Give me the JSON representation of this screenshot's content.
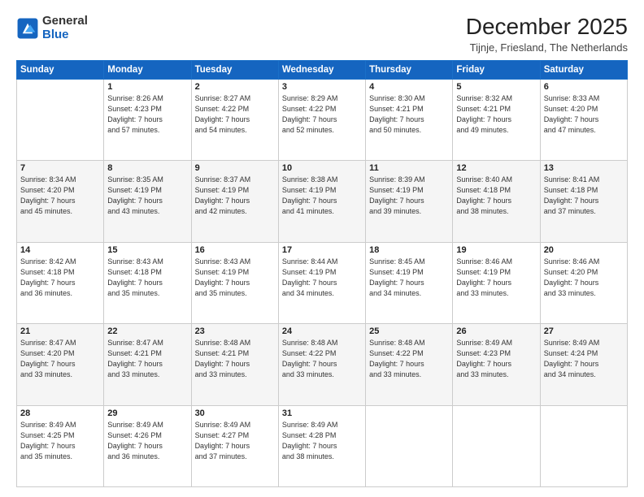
{
  "logo": {
    "line1": "General",
    "line2": "Blue"
  },
  "title": "December 2025",
  "subtitle": "Tijnje, Friesland, The Netherlands",
  "days_header": [
    "Sunday",
    "Monday",
    "Tuesday",
    "Wednesday",
    "Thursday",
    "Friday",
    "Saturday"
  ],
  "weeks": [
    [
      {
        "day": "",
        "info": ""
      },
      {
        "day": "1",
        "info": "Sunrise: 8:26 AM\nSunset: 4:23 PM\nDaylight: 7 hours\nand 57 minutes."
      },
      {
        "day": "2",
        "info": "Sunrise: 8:27 AM\nSunset: 4:22 PM\nDaylight: 7 hours\nand 54 minutes."
      },
      {
        "day": "3",
        "info": "Sunrise: 8:29 AM\nSunset: 4:22 PM\nDaylight: 7 hours\nand 52 minutes."
      },
      {
        "day": "4",
        "info": "Sunrise: 8:30 AM\nSunset: 4:21 PM\nDaylight: 7 hours\nand 50 minutes."
      },
      {
        "day": "5",
        "info": "Sunrise: 8:32 AM\nSunset: 4:21 PM\nDaylight: 7 hours\nand 49 minutes."
      },
      {
        "day": "6",
        "info": "Sunrise: 8:33 AM\nSunset: 4:20 PM\nDaylight: 7 hours\nand 47 minutes."
      }
    ],
    [
      {
        "day": "7",
        "info": "Sunrise: 8:34 AM\nSunset: 4:20 PM\nDaylight: 7 hours\nand 45 minutes."
      },
      {
        "day": "8",
        "info": "Sunrise: 8:35 AM\nSunset: 4:19 PM\nDaylight: 7 hours\nand 43 minutes."
      },
      {
        "day": "9",
        "info": "Sunrise: 8:37 AM\nSunset: 4:19 PM\nDaylight: 7 hours\nand 42 minutes."
      },
      {
        "day": "10",
        "info": "Sunrise: 8:38 AM\nSunset: 4:19 PM\nDaylight: 7 hours\nand 41 minutes."
      },
      {
        "day": "11",
        "info": "Sunrise: 8:39 AM\nSunset: 4:19 PM\nDaylight: 7 hours\nand 39 minutes."
      },
      {
        "day": "12",
        "info": "Sunrise: 8:40 AM\nSunset: 4:18 PM\nDaylight: 7 hours\nand 38 minutes."
      },
      {
        "day": "13",
        "info": "Sunrise: 8:41 AM\nSunset: 4:18 PM\nDaylight: 7 hours\nand 37 minutes."
      }
    ],
    [
      {
        "day": "14",
        "info": "Sunrise: 8:42 AM\nSunset: 4:18 PM\nDaylight: 7 hours\nand 36 minutes."
      },
      {
        "day": "15",
        "info": "Sunrise: 8:43 AM\nSunset: 4:18 PM\nDaylight: 7 hours\nand 35 minutes."
      },
      {
        "day": "16",
        "info": "Sunrise: 8:43 AM\nSunset: 4:19 PM\nDaylight: 7 hours\nand 35 minutes."
      },
      {
        "day": "17",
        "info": "Sunrise: 8:44 AM\nSunset: 4:19 PM\nDaylight: 7 hours\nand 34 minutes."
      },
      {
        "day": "18",
        "info": "Sunrise: 8:45 AM\nSunset: 4:19 PM\nDaylight: 7 hours\nand 34 minutes."
      },
      {
        "day": "19",
        "info": "Sunrise: 8:46 AM\nSunset: 4:19 PM\nDaylight: 7 hours\nand 33 minutes."
      },
      {
        "day": "20",
        "info": "Sunrise: 8:46 AM\nSunset: 4:20 PM\nDaylight: 7 hours\nand 33 minutes."
      }
    ],
    [
      {
        "day": "21",
        "info": "Sunrise: 8:47 AM\nSunset: 4:20 PM\nDaylight: 7 hours\nand 33 minutes."
      },
      {
        "day": "22",
        "info": "Sunrise: 8:47 AM\nSunset: 4:21 PM\nDaylight: 7 hours\nand 33 minutes."
      },
      {
        "day": "23",
        "info": "Sunrise: 8:48 AM\nSunset: 4:21 PM\nDaylight: 7 hours\nand 33 minutes."
      },
      {
        "day": "24",
        "info": "Sunrise: 8:48 AM\nSunset: 4:22 PM\nDaylight: 7 hours\nand 33 minutes."
      },
      {
        "day": "25",
        "info": "Sunrise: 8:48 AM\nSunset: 4:22 PM\nDaylight: 7 hours\nand 33 minutes."
      },
      {
        "day": "26",
        "info": "Sunrise: 8:49 AM\nSunset: 4:23 PM\nDaylight: 7 hours\nand 33 minutes."
      },
      {
        "day": "27",
        "info": "Sunrise: 8:49 AM\nSunset: 4:24 PM\nDaylight: 7 hours\nand 34 minutes."
      }
    ],
    [
      {
        "day": "28",
        "info": "Sunrise: 8:49 AM\nSunset: 4:25 PM\nDaylight: 7 hours\nand 35 minutes."
      },
      {
        "day": "29",
        "info": "Sunrise: 8:49 AM\nSunset: 4:26 PM\nDaylight: 7 hours\nand 36 minutes."
      },
      {
        "day": "30",
        "info": "Sunrise: 8:49 AM\nSunset: 4:27 PM\nDaylight: 7 hours\nand 37 minutes."
      },
      {
        "day": "31",
        "info": "Sunrise: 8:49 AM\nSunset: 4:28 PM\nDaylight: 7 hours\nand 38 minutes."
      },
      {
        "day": "",
        "info": ""
      },
      {
        "day": "",
        "info": ""
      },
      {
        "day": "",
        "info": ""
      }
    ]
  ]
}
